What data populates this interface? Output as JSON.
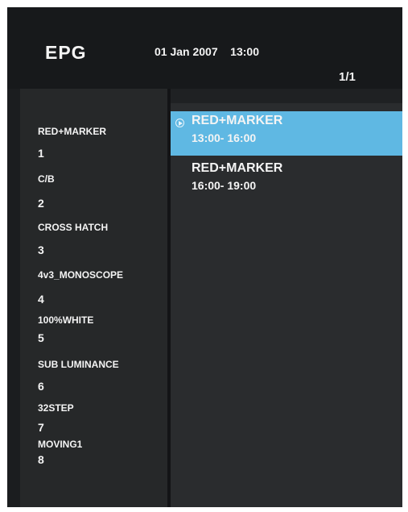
{
  "header": {
    "title": "EPG",
    "datetime": "01 Jan 2007    13:00",
    "page_indicator": "1/1"
  },
  "channels": [
    {
      "name": "RED+MARKER",
      "number": "1"
    },
    {
      "name": "C/B",
      "number": "2"
    },
    {
      "name": "CROSS HATCH",
      "number": "3"
    },
    {
      "name": "4v3_MONOSCOPE",
      "number": "4"
    },
    {
      "name": "100%WHITE",
      "number": "5"
    },
    {
      "name": "SUB LUMINANCE",
      "number": "6"
    },
    {
      "name": "32STEP",
      "number": "7"
    },
    {
      "name": "MOVING1",
      "number": "8"
    }
  ],
  "events": [
    {
      "title": "RED+MARKER",
      "time": "13:00- 16:00",
      "selected": true,
      "icon": "play-icon"
    },
    {
      "title": "RED+MARKER",
      "time": "16:00- 19:00",
      "selected": false
    }
  ],
  "colors": {
    "selection": "#5fb8e3",
    "background": "#1b1d1f",
    "text": "#f4f4f4"
  }
}
